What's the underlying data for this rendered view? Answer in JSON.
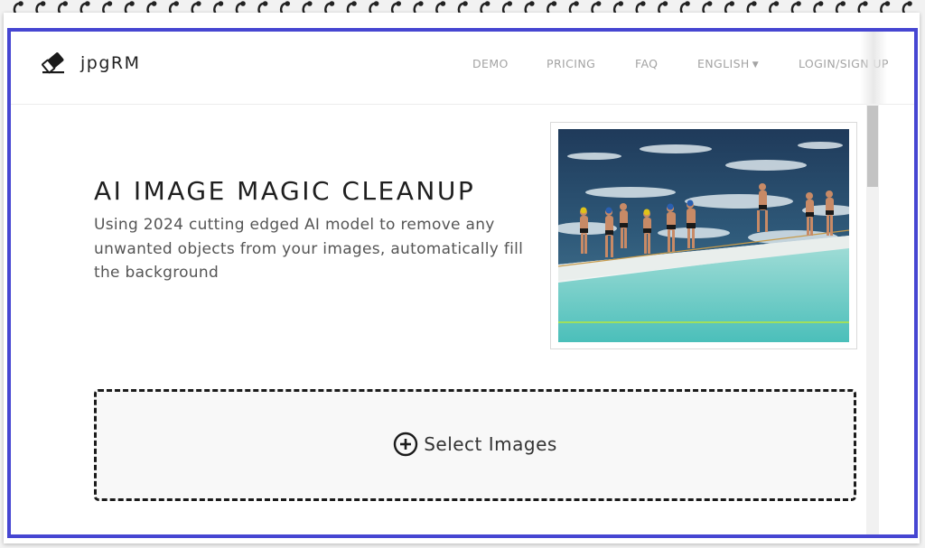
{
  "brand": {
    "name": "jpgRM",
    "logo_icon": "eraser-icon"
  },
  "nav": {
    "items": [
      {
        "label": "DEMO"
      },
      {
        "label": "PRICING"
      },
      {
        "label": "FAQ"
      },
      {
        "label": "ENGLISH",
        "icon": "caret-down-icon"
      },
      {
        "label": "LOGIN/SIGN UP"
      }
    ]
  },
  "hero": {
    "title": "AI IMAGE MAGIC CLEANUP",
    "subtitle": "Using 2024 cutting edged AI model to remove any unwanted objects from your images, automatically fill the background",
    "image_icon": "swimmers-photo"
  },
  "upload": {
    "label": "Select Images",
    "icon": "plus-circle-icon"
  },
  "colors": {
    "frame_border": "#4646d2",
    "nav_text": "#a3a3a3",
    "title_text": "#1f1f1f"
  }
}
